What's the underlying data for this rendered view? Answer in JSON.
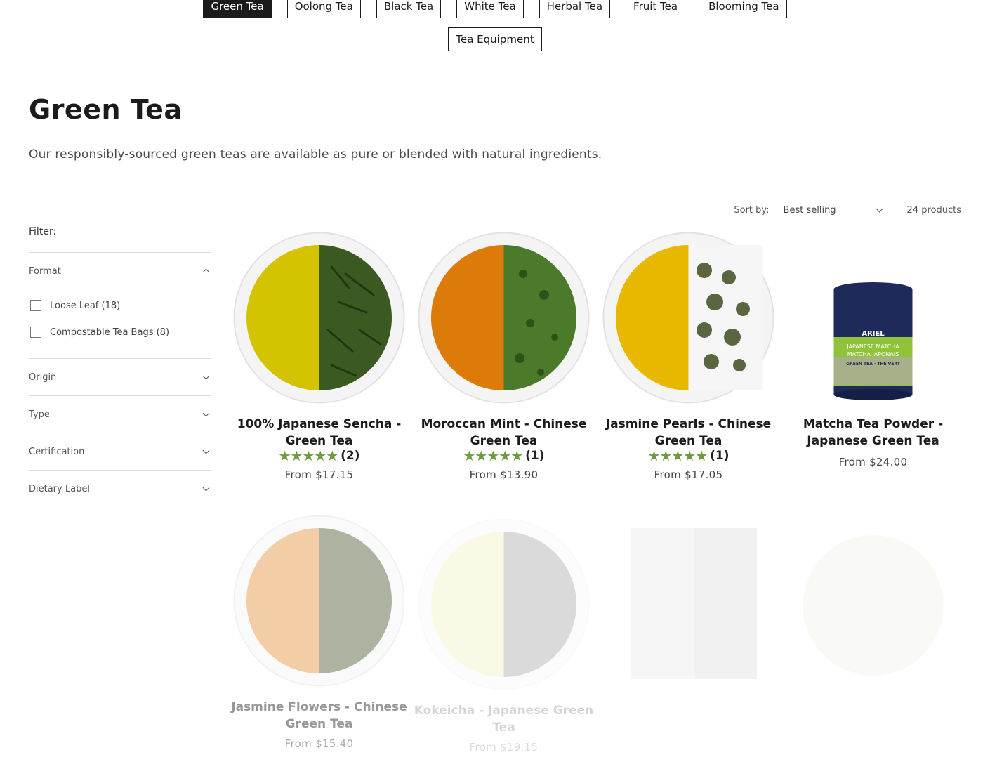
{
  "categories_row1": [
    "Green Tea",
    "Oolong Tea",
    "Black Tea",
    "White Tea",
    "Herbal Tea",
    "Fruit Tea",
    "Blooming Tea"
  ],
  "categories_row2": [
    "Tea Equipment"
  ],
  "active_category": "Green Tea",
  "page": {
    "title": "Green Tea",
    "description": "Our responsibly-sourced green teas are available as pure or blended with natural ingredients."
  },
  "sort": {
    "label": "Sort by:",
    "value": "Best selling",
    "count": "24 products"
  },
  "filters": {
    "title": "Filter:",
    "groups": [
      {
        "label": "Format",
        "expanded": true,
        "options": [
          "Loose Leaf (18)",
          "Compostable Tea Bags (8)"
        ]
      },
      {
        "label": "Origin",
        "expanded": false
      },
      {
        "label": "Type",
        "expanded": false
      },
      {
        "label": "Certification",
        "expanded": false
      },
      {
        "label": "Dietary Label",
        "expanded": false
      }
    ]
  },
  "products": [
    {
      "title_line1": "100% Japanese Sencha -",
      "title_line2": "Green Tea",
      "stars": "★★★★★",
      "reviews": "(2)",
      "price": "From $17.15",
      "liquor": "#d3c300",
      "leaf": "#3a5a22"
    },
    {
      "title_line1": "Moroccan Mint - Chinese",
      "title_line2": "Green Tea",
      "stars": "★★★★★",
      "reviews": "(1)",
      "price": "From $13.90",
      "liquor": "#dc7a0a",
      "leaf": "#4b7a2a"
    },
    {
      "title_line1": "Jasmine Pearls - Chinese",
      "title_line2": "Green Tea",
      "stars": "★★★★★",
      "reviews": "(1)",
      "price": "From $17.05",
      "liquor": "#e8b800",
      "leaf": "#5a6640"
    },
    {
      "title_line1": "Matcha Tea Powder -",
      "title_line2": "Japanese Green Tea",
      "price": "From $24.00",
      "tin_brand": "ARIEL",
      "tin_label_1": "JAPANESE MATCHA",
      "tin_label_2": "MATCHA JAPONAIS",
      "tin_label_3": "GREEN TEA · THÉ VERT"
    },
    {
      "title_line1": "Jasmine Flowers - Chinese",
      "title_line2": "Green Tea",
      "price": "From $15.40",
      "liquor": "#e3923a",
      "leaf": "#4a5a30"
    },
    {
      "title_line1": "Kokeicha - Japanese Green",
      "title_line2": "Tea",
      "price": "From $19.15"
    }
  ]
}
